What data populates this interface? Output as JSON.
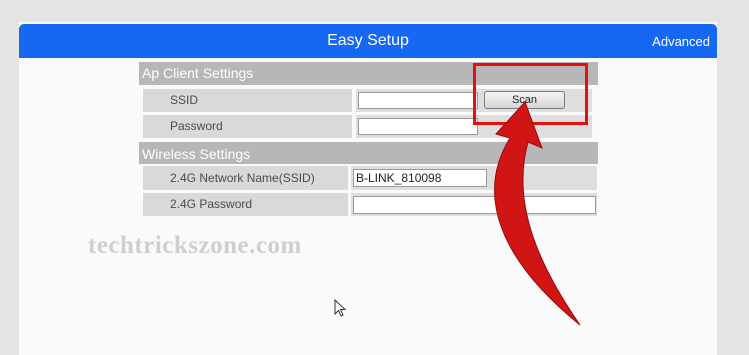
{
  "header": {
    "title": "Easy Setup",
    "advanced_label": "Advanced"
  },
  "ap_client": {
    "heading": "Ap Client Settings",
    "ssid_label": "SSID",
    "ssid_value": "",
    "scan_label": "Scan",
    "password_label": "Password",
    "password_value": ""
  },
  "wireless": {
    "heading": "Wireless Settings",
    "network_name_label": "2.4G Network Name(SSID)",
    "network_name_value": "B-LINK_810098",
    "password_label": "2.4G Password",
    "password_value": ""
  },
  "watermark": "techtrickszone.com",
  "colors": {
    "accent": "#1667f1",
    "highlight": "#e41010",
    "section": "#b7b7b7"
  },
  "icons": {
    "cursor": "mouse-pointer-icon",
    "annotation": "curved-arrow-icon"
  }
}
